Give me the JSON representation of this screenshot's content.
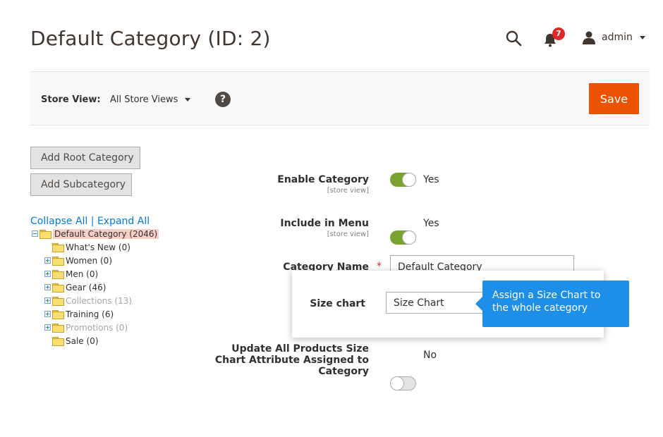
{
  "header": {
    "title": "Default Category (ID: 2)",
    "notifications_count": "7",
    "user_name": "admin"
  },
  "store_bar": {
    "label": "Store View:",
    "selected": "All Store Views",
    "help": "?",
    "save_label": "Save"
  },
  "buttons": {
    "add_root": "Add Root Category",
    "add_sub": "Add Subcategory"
  },
  "tree": {
    "collapse_all": "Collapse All",
    "separator": "|",
    "expand_all": "Expand All",
    "root": "Default Category (2046)",
    "children": [
      "What's New (0)",
      "Women (0)",
      "Men (0)",
      "Gear (46)",
      "Collections (13)",
      "Training (6)",
      "Promotions (0)",
      "Sale (0)"
    ]
  },
  "form": {
    "enable_category": {
      "label": "Enable Category",
      "scope": "[store view]",
      "value": "Yes"
    },
    "include_in_menu": {
      "label": "Include in Menu",
      "scope": "[store view]",
      "value": "Yes"
    },
    "category_name": {
      "label": "Category Name",
      "required_mark": "*",
      "value": "Default Category"
    },
    "size_chart": {
      "label": "Size chart",
      "value": "Size Chart"
    },
    "update_all": {
      "label_line1": "Update All Products Size",
      "label_line2": "Chart Attribute Assigned to",
      "label_line3": "Category",
      "value": "No"
    }
  },
  "tooltip": {
    "text": "Assign a Size Chart to the whole category"
  },
  "colors": {
    "accent": "#eb5202",
    "toggle_on": "#79a22e",
    "tooltip": "#1e8fe8",
    "link": "#007bdb",
    "badge": "#e22626"
  }
}
